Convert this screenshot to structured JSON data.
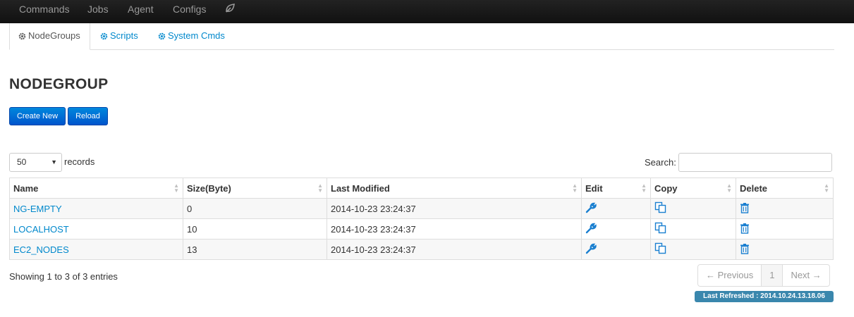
{
  "navbar": {
    "items": [
      "Commands",
      "Jobs",
      "Agent",
      "Configs"
    ],
    "leaf_icon": "leaf-icon"
  },
  "tabs": [
    {
      "label": "NodeGroups",
      "icon": "gear-icon",
      "active": true
    },
    {
      "label": "Scripts",
      "icon": "gear-icon",
      "active": false
    },
    {
      "label": "System Cmds",
      "icon": "gear-icon",
      "active": false
    }
  ],
  "page": {
    "title": "NODEGROUP"
  },
  "buttons": {
    "create": "Create New",
    "reload": "Reload"
  },
  "length": {
    "value": "50",
    "suffix": "records"
  },
  "search": {
    "label": "Search:",
    "value": ""
  },
  "table": {
    "headers": [
      "Name",
      "Size(Byte)",
      "Last Modified",
      "Edit",
      "Copy",
      "Delete"
    ],
    "rows": [
      {
        "name": "NG-EMPTY",
        "size": "0",
        "modified": "2014-10-23 23:24:37"
      },
      {
        "name": "LOCALHOST",
        "size": "10",
        "modified": "2014-10-23 23:24:37"
      },
      {
        "name": "EC2_NODES",
        "size": "13",
        "modified": "2014-10-23 23:24:37"
      }
    ]
  },
  "info": "Showing 1 to 3 of 3 entries",
  "pagination": {
    "previous": "← Previous",
    "page": "1",
    "next": "Next →"
  },
  "refresh": "Last Refreshed : 2014.10.24.13.18.06",
  "colors": {
    "link": "#0088cc",
    "navbar": "#1b1b1b",
    "primary": "#0066cc",
    "badge": "#3a87ad"
  }
}
